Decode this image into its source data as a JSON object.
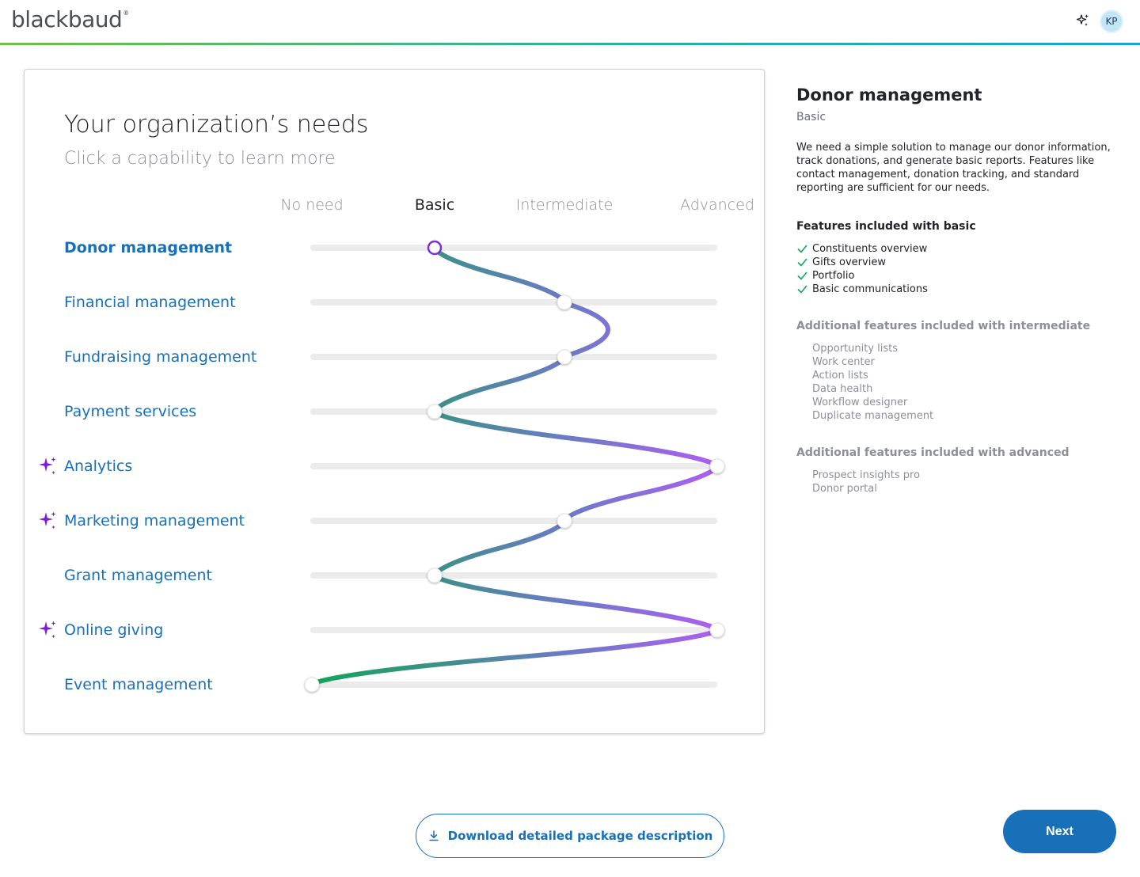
{
  "header": {
    "logo_text": "blackbaud",
    "logo_mark": "®",
    "ai_icon": "sparkle-icon",
    "avatar_initials": "KP"
  },
  "card": {
    "title": "Your organization’s needs",
    "subtitle": "Click a capability to learn more",
    "levels": [
      "No need",
      "Basic",
      "Intermediate",
      "Advanced"
    ],
    "active_level_index": 1,
    "capabilities": [
      {
        "label": "Donor management",
        "level": 1,
        "ai": false,
        "selected": true
      },
      {
        "label": "Financial management",
        "level": 2,
        "ai": false,
        "selected": false
      },
      {
        "label": "Fundraising management",
        "level": 2,
        "ai": false,
        "selected": false
      },
      {
        "label": "Payment services",
        "level": 1,
        "ai": false,
        "selected": false
      },
      {
        "label": "Analytics",
        "level": 3,
        "ai": true,
        "selected": false
      },
      {
        "label": "Marketing management",
        "level": 2,
        "ai": true,
        "selected": false
      },
      {
        "label": "Grant management",
        "level": 1,
        "ai": false,
        "selected": false
      },
      {
        "label": "Online giving",
        "level": 3,
        "ai": true,
        "selected": false
      },
      {
        "label": "Event management",
        "level": 0,
        "ai": false,
        "selected": false
      }
    ]
  },
  "colors": {
    "brand_blue": "#1870b8",
    "green": "#12a55a",
    "teal": "#3f8f8a",
    "purple": "#a85cf0",
    "selected_knob": "#7b2fd6",
    "ai_icon": "#7b1fd8"
  },
  "panel": {
    "title": "Donor management",
    "level": "Basic",
    "description": "We need a simple solution to manage our donor information, track donations, and generate basic reports. Features like contact management, donation tracking, and standard reporting are sufficient for our needs.",
    "basic_heading": "Features included with basic",
    "basic_features": [
      "Constituents overview",
      "Gifts overview",
      "Portfolio",
      "Basic communications"
    ],
    "intermediate_heading": "Additional features included with intermediate",
    "intermediate_features": [
      "Opportunity lists",
      "Work center",
      "Action lists",
      "Data health",
      "Workflow designer",
      "Duplicate management"
    ],
    "advanced_heading": "Additional features included with advanced",
    "advanced_features": [
      "Prospect insights pro",
      "Donor portal"
    ]
  },
  "buttons": {
    "download_label": "Download detailed package description",
    "next_label": "Next"
  }
}
